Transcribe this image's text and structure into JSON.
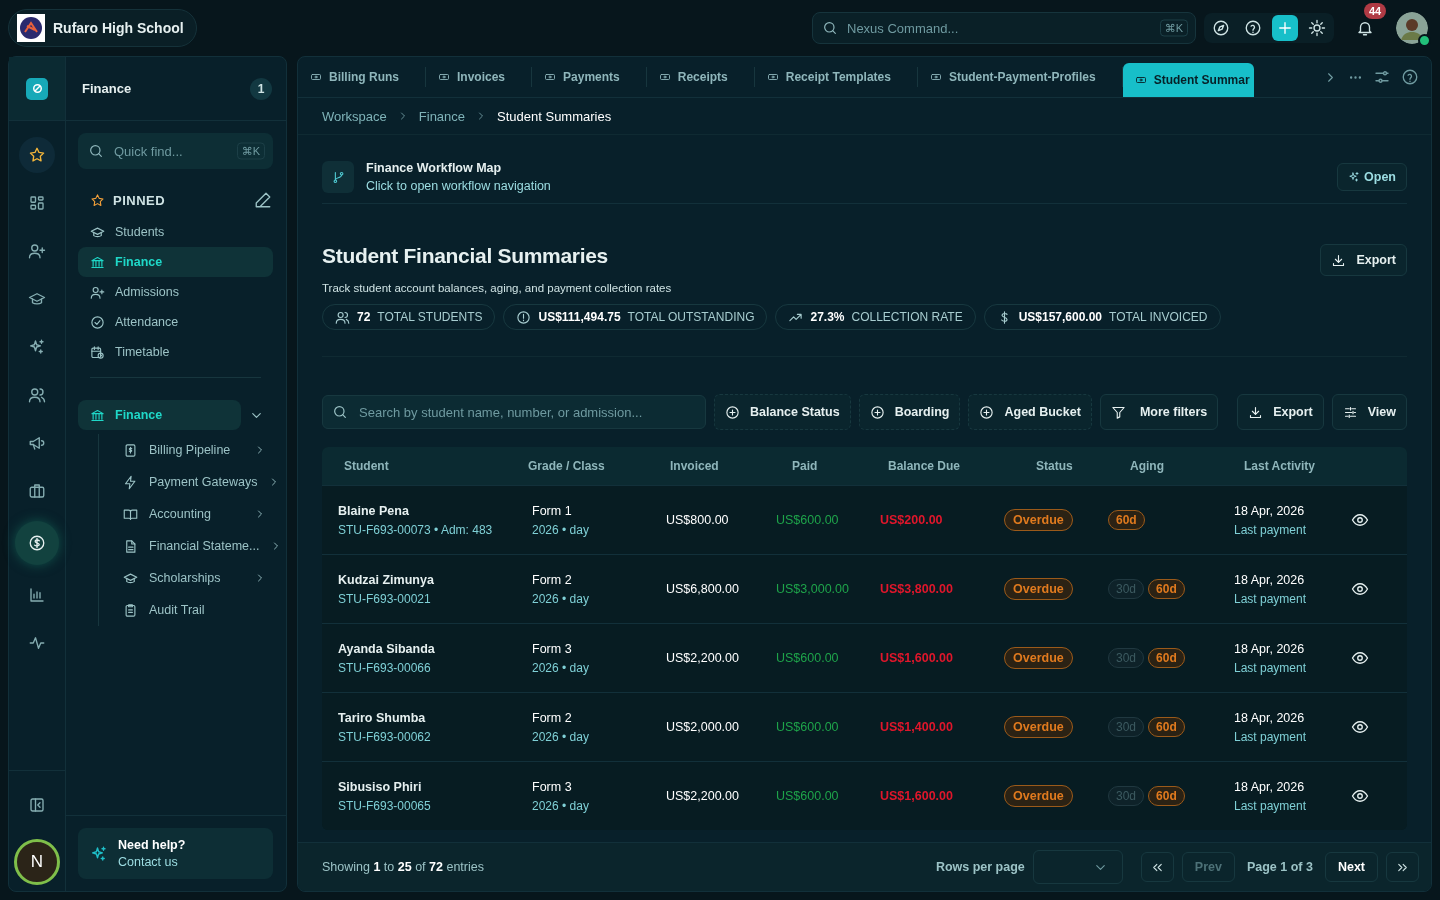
{
  "school": {
    "name": "Rufaro High School"
  },
  "command_search": {
    "placeholder": "Nexus Command...",
    "shortcut": "⌘K"
  },
  "notifications": {
    "count": "44"
  },
  "rail": [
    {
      "selected": false
    },
    {
      "selected": false
    },
    {
      "selected": false
    },
    {
      "selected": false
    },
    {
      "selected": false
    },
    {
      "selected": false
    },
    {
      "selected": false
    },
    {
      "selected": false
    },
    {
      "selected": true
    },
    {
      "selected": false
    },
    {
      "selected": false
    }
  ],
  "user_initial": "N",
  "sidebar": {
    "title": "Finance",
    "count": "1",
    "search": {
      "placeholder": "Quick find...",
      "shortcut": "⌘K"
    },
    "pinned_label": "PINNED",
    "pinned": [
      {
        "label": "Students",
        "selected": false
      },
      {
        "label": "Finance",
        "selected": true
      },
      {
        "label": "Admissions",
        "selected": false
      },
      {
        "label": "Attendance",
        "selected": false
      },
      {
        "label": "Timetable",
        "selected": false
      }
    ],
    "group": {
      "label": "Finance",
      "expanded": true,
      "children": [
        {
          "label": "Billing Pipeline",
          "expandable": true
        },
        {
          "label": "Payment Gateways",
          "expandable": true
        },
        {
          "label": "Accounting",
          "expandable": true
        },
        {
          "label": "Financial Stateme...",
          "expandable": true
        },
        {
          "label": "Scholarships",
          "expandable": true
        },
        {
          "label": "Audit Trail",
          "expandable": false
        }
      ]
    },
    "help": {
      "title": "Need help?",
      "link": "Contact us"
    }
  },
  "tabs": [
    {
      "label": "Billing Runs",
      "selected": false
    },
    {
      "label": "Invoices",
      "selected": false
    },
    {
      "label": "Payments",
      "selected": false
    },
    {
      "label": "Receipts",
      "selected": false
    },
    {
      "label": "Receipt Templates",
      "selected": false
    },
    {
      "label": "Student-Payment-Profiles",
      "selected": false
    },
    {
      "label": "Student Summar",
      "selected": true
    }
  ],
  "breadcrumb": [
    "Workspace",
    "Finance",
    "Student Summaries"
  ],
  "workflow": {
    "title": "Finance Workflow Map",
    "subtitle": "Click to open workflow navigation",
    "button": "Open"
  },
  "page": {
    "title": "Student Financial Summaries",
    "subtitle": "Track student account balances, aging, and payment collection rates",
    "export": "Export"
  },
  "stats": [
    {
      "value": "72",
      "label": "TOTAL STUDENTS"
    },
    {
      "value": "US$111,494.75",
      "label": "TOTAL OUTSTANDING"
    },
    {
      "value": "27.3%",
      "label": "COLLECTION RATE"
    },
    {
      "value": "US$157,600.00",
      "label": "TOTAL INVOICED"
    }
  ],
  "toolbar": {
    "search": {
      "placeholder": "Search by student name, number, or admission..."
    },
    "filters": [
      {
        "label": "Balance Status",
        "kind": "facet"
      },
      {
        "label": "Boarding",
        "kind": "facet"
      },
      {
        "label": "Aged Bucket",
        "kind": "facet"
      },
      {
        "label": "More filters",
        "kind": "more"
      }
    ],
    "export": "Export",
    "view": "View"
  },
  "table": {
    "columns": [
      "Student",
      "Grade / Class",
      "Invoiced",
      "Paid",
      "Balance Due",
      "Status",
      "Aging",
      "Last Activity"
    ],
    "rows": [
      {
        "name": "Blaine Pena",
        "id": "STU-F693-00073 • Adm: 483",
        "grade": "Form 1",
        "term": "2026 • day",
        "invoiced": "US$800.00",
        "paid": "US$600.00",
        "balance": "US$200.00",
        "status": "Overdue",
        "aging": [
          {
            "label": "60d",
            "active": true
          }
        ],
        "date": "18 Apr, 2026",
        "activity": "Last payment"
      },
      {
        "name": "Kudzai Zimunya",
        "id": "STU-F693-00021",
        "grade": "Form 2",
        "term": "2026 • day",
        "invoiced": "US$6,800.00",
        "paid": "US$3,000.00",
        "balance": "US$3,800.00",
        "status": "Overdue",
        "aging": [
          {
            "label": "30d",
            "active": false
          },
          {
            "label": "60d",
            "active": true
          }
        ],
        "date": "18 Apr, 2026",
        "activity": "Last payment"
      },
      {
        "name": "Ayanda Sibanda",
        "id": "STU-F693-00066",
        "grade": "Form 3",
        "term": "2026 • day",
        "invoiced": "US$2,200.00",
        "paid": "US$600.00",
        "balance": "US$1,600.00",
        "status": "Overdue",
        "aging": [
          {
            "label": "30d",
            "active": false
          },
          {
            "label": "60d",
            "active": true
          }
        ],
        "date": "18 Apr, 2026",
        "activity": "Last payment"
      },
      {
        "name": "Tariro Shumba",
        "id": "STU-F693-00062",
        "grade": "Form 2",
        "term": "2026 • day",
        "invoiced": "US$2,000.00",
        "paid": "US$600.00",
        "balance": "US$1,400.00",
        "status": "Overdue",
        "aging": [
          {
            "label": "30d",
            "active": false
          },
          {
            "label": "60d",
            "active": true
          }
        ],
        "date": "18 Apr, 2026",
        "activity": "Last payment"
      },
      {
        "name": "Sibusiso Phiri",
        "id": "STU-F693-00065",
        "grade": "Form 3",
        "term": "2026 • day",
        "invoiced": "US$2,200.00",
        "paid": "US$600.00",
        "balance": "US$1,600.00",
        "status": "Overdue",
        "aging": [
          {
            "label": "30d",
            "active": false
          },
          {
            "label": "60d",
            "active": true
          }
        ],
        "date": "18 Apr, 2026",
        "activity": "Last payment"
      }
    ]
  },
  "pagination": {
    "summary": "Showing **1** to **25** of **72** entries",
    "rows_label": "Rows per page",
    "prev": "Prev",
    "page": "Page 1 of 3",
    "next": "Next"
  }
}
